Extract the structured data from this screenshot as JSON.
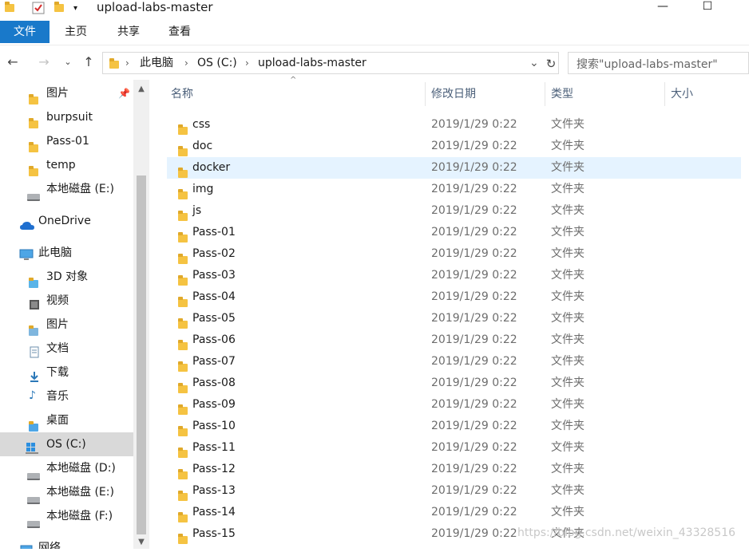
{
  "titlebar": {
    "title": "upload-labs-master",
    "minimize_glyph": "—",
    "maximize_glyph": "☐"
  },
  "ribbon": {
    "tabs": [
      {
        "label": "文件",
        "active": true
      },
      {
        "label": "主页",
        "active": false
      },
      {
        "label": "共享",
        "active": false
      },
      {
        "label": "查看",
        "active": false
      }
    ]
  },
  "address": {
    "segments": [
      "此电脑",
      "OS (C:)",
      "upload-labs-master"
    ],
    "search_placeholder": "搜索\"upload-labs-master\""
  },
  "sidebar": {
    "items": [
      {
        "label": "图片",
        "icon": "pictures-folder-icon",
        "pinned": true
      },
      {
        "label": "burpsuit",
        "icon": "folder-icon"
      },
      {
        "label": "Pass-01",
        "icon": "folder-icon"
      },
      {
        "label": "temp",
        "icon": "folder-icon"
      },
      {
        "label": "本地磁盘 (E:)",
        "icon": "drive-icon"
      },
      {
        "label": "OneDrive",
        "icon": "onedrive-icon"
      },
      {
        "label": "此电脑",
        "icon": "this-pc-icon"
      },
      {
        "label": "3D 对象",
        "icon": "3d-objects-icon"
      },
      {
        "label": "视频",
        "icon": "videos-icon"
      },
      {
        "label": "图片",
        "icon": "pictures-icon"
      },
      {
        "label": "文档",
        "icon": "documents-icon"
      },
      {
        "label": "下载",
        "icon": "downloads-icon"
      },
      {
        "label": "音乐",
        "icon": "music-icon"
      },
      {
        "label": "桌面",
        "icon": "desktop-icon"
      },
      {
        "label": "OS (C:)",
        "icon": "windows-drive-icon",
        "selected": true
      },
      {
        "label": "本地磁盘 (D:)",
        "icon": "drive-icon"
      },
      {
        "label": "本地磁盘 (E:)",
        "icon": "drive-icon"
      },
      {
        "label": "本地磁盘 (F:)",
        "icon": "drive-icon"
      },
      {
        "label": "网络",
        "icon": "network-icon"
      }
    ]
  },
  "columns": {
    "name": "名称",
    "date": "修改日期",
    "type": "类型",
    "size": "大小"
  },
  "files": [
    {
      "name": "css",
      "date": "2019/1/29 0:22",
      "type": "文件夹"
    },
    {
      "name": "doc",
      "date": "2019/1/29 0:22",
      "type": "文件夹"
    },
    {
      "name": "docker",
      "date": "2019/1/29 0:22",
      "type": "文件夹",
      "selected": true
    },
    {
      "name": "img",
      "date": "2019/1/29 0:22",
      "type": "文件夹"
    },
    {
      "name": "js",
      "date": "2019/1/29 0:22",
      "type": "文件夹"
    },
    {
      "name": "Pass-01",
      "date": "2019/1/29 0:22",
      "type": "文件夹"
    },
    {
      "name": "Pass-02",
      "date": "2019/1/29 0:22",
      "type": "文件夹"
    },
    {
      "name": "Pass-03",
      "date": "2019/1/29 0:22",
      "type": "文件夹"
    },
    {
      "name": "Pass-04",
      "date": "2019/1/29 0:22",
      "type": "文件夹"
    },
    {
      "name": "Pass-05",
      "date": "2019/1/29 0:22",
      "type": "文件夹"
    },
    {
      "name": "Pass-06",
      "date": "2019/1/29 0:22",
      "type": "文件夹"
    },
    {
      "name": "Pass-07",
      "date": "2019/1/29 0:22",
      "type": "文件夹"
    },
    {
      "name": "Pass-08",
      "date": "2019/1/29 0:22",
      "type": "文件夹"
    },
    {
      "name": "Pass-09",
      "date": "2019/1/29 0:22",
      "type": "文件夹"
    },
    {
      "name": "Pass-10",
      "date": "2019/1/29 0:22",
      "type": "文件夹"
    },
    {
      "name": "Pass-11",
      "date": "2019/1/29 0:22",
      "type": "文件夹"
    },
    {
      "name": "Pass-12",
      "date": "2019/1/29 0:22",
      "type": "文件夹"
    },
    {
      "name": "Pass-13",
      "date": "2019/1/29 0:22",
      "type": "文件夹"
    },
    {
      "name": "Pass-14",
      "date": "2019/1/29 0:22",
      "type": "文件夹"
    },
    {
      "name": "Pass-15",
      "date": "2019/1/29 0:22",
      "type": "文件夹"
    }
  ],
  "watermark": "https://blog.csdn.net/weixin_43328516",
  "colors": {
    "accent": "#1979ca",
    "folder": "#f5c342",
    "selection": "#e5f3ff",
    "sidebar_selected": "#d9d9d9"
  }
}
